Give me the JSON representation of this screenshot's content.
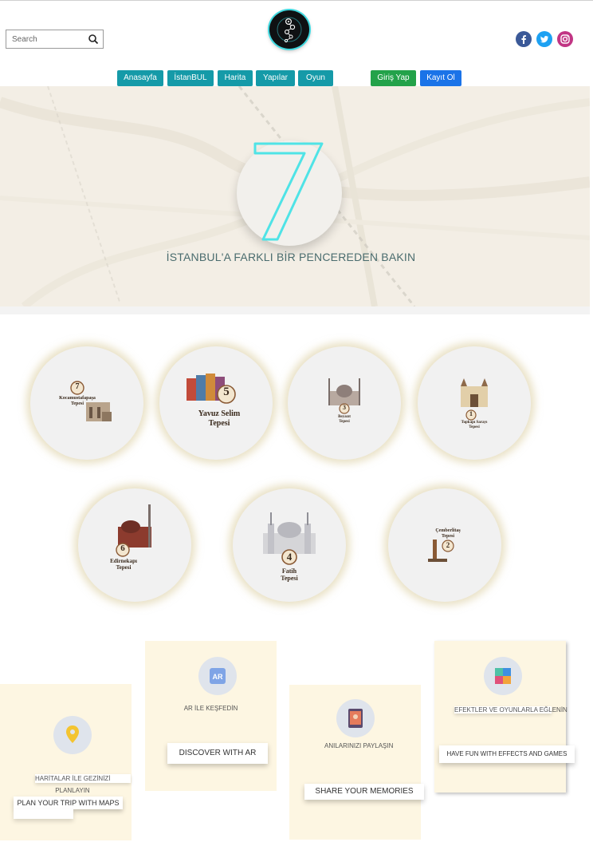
{
  "search": {
    "placeholder": "Search"
  },
  "nav": {
    "items": [
      {
        "label": "Anasayfa"
      },
      {
        "label": "İstanBUL"
      },
      {
        "label": "Harita"
      },
      {
        "label": "Yapılar"
      },
      {
        "label": "Oyun"
      }
    ],
    "login_label": "Giriş Yap",
    "register_label": "Kayıt Ol"
  },
  "social": [
    "facebook-icon",
    "twitter-icon",
    "instagram-icon"
  ],
  "colors": {
    "teal": "#159aa8",
    "green": "#23a24a",
    "blue": "#1a73e8",
    "hero_seven": "#4fe3e6",
    "card_bg": "#fdf6e2"
  },
  "hero": {
    "numeral": "7",
    "tagline": "İSTANBUL'A FARKLI BİR PENCEREDEN BAKIN"
  },
  "hills": [
    {
      "number": "7",
      "name_line1": "Kocamustafapaşa",
      "name_line2": "Tepesi"
    },
    {
      "number": "5",
      "name_line1": "Yavuz Selim",
      "name_line2": "Tepesi"
    },
    {
      "number": "3",
      "name_line1": "Beyazıt",
      "name_line2": "Tepesi"
    },
    {
      "number": "1",
      "name_line1": "Topkapı Sarayı",
      "name_line2": "Tepesi"
    },
    {
      "number": "6",
      "name_line1": "Edirnekapı",
      "name_line2": "Tepesi"
    },
    {
      "number": "4",
      "name_line1": "Fatih",
      "name_line2": "Tepesi"
    },
    {
      "number": "2",
      "name_line1": "Çemberlitaş",
      "name_line2": "Tepesi"
    }
  ],
  "features": [
    {
      "icon": "map-pin-icon",
      "subtitle_line1": "HARİTALAR İLE GEZİNİZİ",
      "subtitle_line2": "PLANLAYIN",
      "button": "PLAN YOUR TRIP WITH MAPS"
    },
    {
      "icon": "ar-icon",
      "icon_text": "AR",
      "subtitle_line1": "AR İLE KEŞFEDİN",
      "button": "DISCOVER WITH AR"
    },
    {
      "icon": "photo-share-icon",
      "subtitle_line1": "ANILARINIZI PAYLAŞIN",
      "button": "SHARE YOUR MEMORIES"
    },
    {
      "icon": "puzzle-icon",
      "subtitle_line1": "EFEKTLER VE OYUNLARLA EĞLENİN",
      "button": "HAVE FUN WITH EFFECTS AND GAMES"
    }
  ]
}
